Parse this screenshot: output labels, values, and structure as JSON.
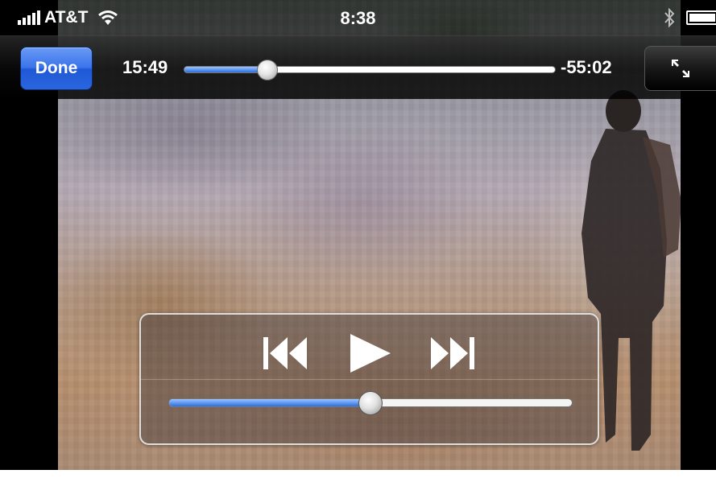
{
  "status_bar": {
    "carrier": "AT&T",
    "time": "8:38",
    "icons": [
      "signal-bars-icon",
      "wifi-icon",
      "bluetooth-icon",
      "battery-icon"
    ]
  },
  "player": {
    "done_label": "Done",
    "time_elapsed": "15:49",
    "time_remaining": "-55:02",
    "scrubber_progress": 0.223,
    "volume_level": 0.5,
    "icons": {
      "fullscreen": "fullscreen-toggle-icon",
      "previous": "skip-back-icon",
      "play": "play-icon",
      "next": "skip-forward-icon"
    }
  },
  "colors": {
    "accent_blue": "#2b6fe0",
    "done_button": "#3a74ea"
  }
}
